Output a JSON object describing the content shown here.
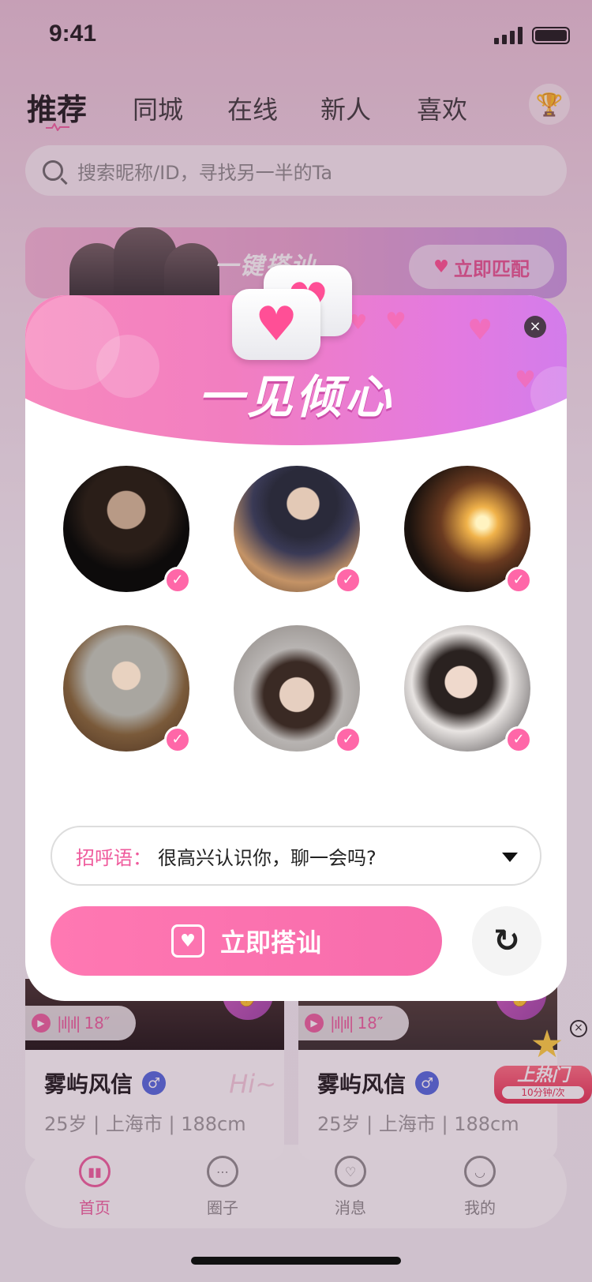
{
  "status": {
    "time": "9:41"
  },
  "tabs": [
    {
      "label": "推荐",
      "active": true
    },
    {
      "label": "同城"
    },
    {
      "label": "在线"
    },
    {
      "label": "新人"
    },
    {
      "label": "喜欢"
    }
  ],
  "search": {
    "placeholder": "搜索昵称/ID，寻找另一半的Ta"
  },
  "banner": {
    "title": "一键搭讪",
    "button": "立即匹配"
  },
  "cards": [
    {
      "duration": "18″",
      "name": "雾屿风信",
      "age": "25岁",
      "city": "上海市",
      "height": "188cm",
      "hi": "Hi~"
    },
    {
      "duration": "18″",
      "name": "雾屿风信",
      "age": "25岁",
      "city": "上海市",
      "height": "188cm"
    }
  ],
  "hot_badge": {
    "title": "上热门",
    "subtitle": "10分钟/次"
  },
  "nav": [
    {
      "label": "首页",
      "icon": "home-icon",
      "active": true
    },
    {
      "label": "圈子",
      "icon": "circle-icon"
    },
    {
      "label": "消息",
      "icon": "message-icon"
    },
    {
      "label": "我的",
      "icon": "profile-icon"
    }
  ],
  "modal": {
    "title": "一见倾心",
    "greeting_label": "招呼语：",
    "greeting_text": "很高兴认识你，聊一会吗?",
    "cta": "立即搭讪",
    "close": "×",
    "avatars_selected": [
      true,
      true,
      true,
      true,
      true,
      true
    ]
  },
  "colors": {
    "accent": "#ff67a8",
    "header_start": "#f88bbd",
    "header_end": "#cc7ef0"
  }
}
